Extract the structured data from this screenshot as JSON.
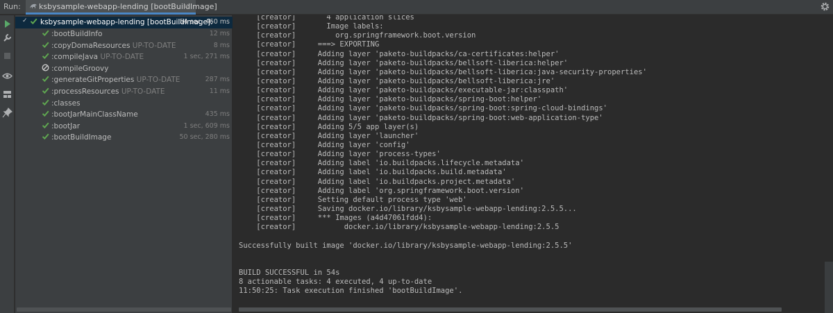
{
  "run_label": "Run:",
  "tab": {
    "title": "ksbysample-webapp-lending [bootBuildImage]",
    "close": "×"
  },
  "icons": {
    "rerun": "play-icon",
    "settings": "wrench-icon",
    "stop": "stop-icon",
    "eye": "eye-icon",
    "layout": "layout-icon",
    "pin": "pin-icon",
    "gear": "gear-icon",
    "check_color": "#5fa650",
    "selection_color": "#0d293e"
  },
  "tree": {
    "root": {
      "label": "ksbysample-webapp-lending [bootBuildImage]:",
      "time": "54 sec, 460 ms"
    },
    "tasks": [
      {
        "name": ":bootBuildInfo",
        "status": "",
        "time": "12 ms",
        "state": "success"
      },
      {
        "name": ":copyDomaResources",
        "status": "UP-TO-DATE",
        "time": "8 ms",
        "state": "success"
      },
      {
        "name": ":compileJava",
        "status": "UP-TO-DATE",
        "time": "1 sec, 271 ms",
        "state": "success"
      },
      {
        "name": ":compileGroovy",
        "status": "",
        "time": "",
        "state": "skipped"
      },
      {
        "name": ":generateGitProperties",
        "status": "UP-TO-DATE",
        "time": "287 ms",
        "state": "success"
      },
      {
        "name": ":processResources",
        "status": "UP-TO-DATE",
        "time": "11 ms",
        "state": "success"
      },
      {
        "name": ":classes",
        "status": "",
        "time": "",
        "state": "success"
      },
      {
        "name": ":bootJarMainClassName",
        "status": "",
        "time": "435 ms",
        "state": "success"
      },
      {
        "name": ":bootJar",
        "status": "",
        "time": "1 sec, 609 ms",
        "state": "success"
      },
      {
        "name": ":bootBuildImage",
        "status": "",
        "time": "50 sec, 280 ms",
        "state": "success"
      }
    ]
  },
  "console": {
    "lines": [
      "    [creator]       4 application slices",
      "    [creator]       Image labels:",
      "    [creator]         org.springframework.boot.version",
      "    [creator]     ===> EXPORTING",
      "    [creator]     Adding layer 'paketo-buildpacks/ca-certificates:helper'",
      "    [creator]     Adding layer 'paketo-buildpacks/bellsoft-liberica:helper'",
      "    [creator]     Adding layer 'paketo-buildpacks/bellsoft-liberica:java-security-properties'",
      "    [creator]     Adding layer 'paketo-buildpacks/bellsoft-liberica:jre'",
      "    [creator]     Adding layer 'paketo-buildpacks/executable-jar:classpath'",
      "    [creator]     Adding layer 'paketo-buildpacks/spring-boot:helper'",
      "    [creator]     Adding layer 'paketo-buildpacks/spring-boot:spring-cloud-bindings'",
      "    [creator]     Adding layer 'paketo-buildpacks/spring-boot:web-application-type'",
      "    [creator]     Adding 5/5 app layer(s)",
      "    [creator]     Adding layer 'launcher'",
      "    [creator]     Adding layer 'config'",
      "    [creator]     Adding layer 'process-types'",
      "    [creator]     Adding label 'io.buildpacks.lifecycle.metadata'",
      "    [creator]     Adding label 'io.buildpacks.build.metadata'",
      "    [creator]     Adding label 'io.buildpacks.project.metadata'",
      "    [creator]     Adding label 'org.springframework.boot.version'",
      "    [creator]     Setting default process type 'web'",
      "    [creator]     Saving docker.io/library/ksbysample-webapp-lending:2.5.5...",
      "    [creator]     *** Images (a4d47061fdd4):",
      "    [creator]           docker.io/library/ksbysample-webapp-lending:2.5.5",
      "",
      "Successfully built image 'docker.io/library/ksbysample-webapp-lending:2.5.5'",
      "",
      "",
      "BUILD SUCCESSFUL in 54s",
      "8 actionable tasks: 4 executed, 4 up-to-date",
      "11:50:25: Task execution finished 'bootBuildImage'."
    ]
  }
}
